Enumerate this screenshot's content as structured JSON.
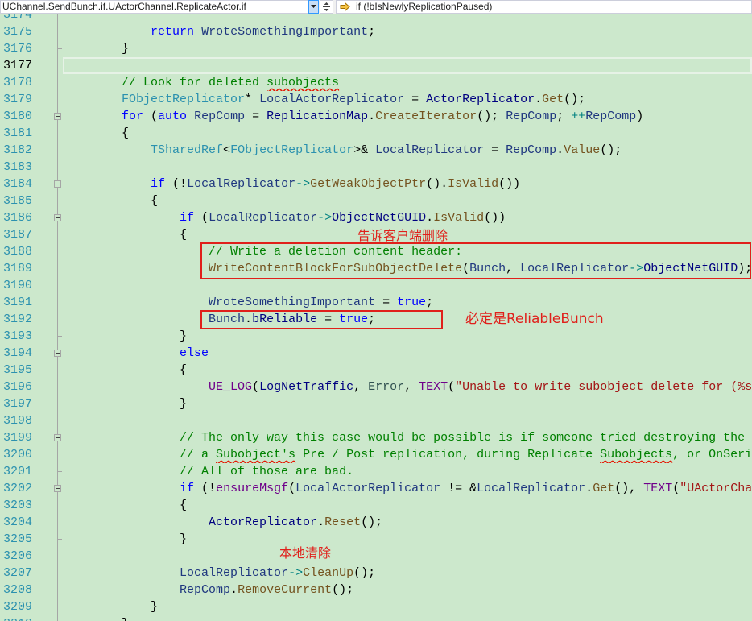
{
  "navbar": {
    "scope_dropdown": {
      "value": "UChannel.SendBunch.if.UActorChannel.ReplicateActor.if"
    },
    "scope_button_icon": "chevron-down-icon",
    "split_button_icon": "split-window-icon",
    "member_dropdown": {
      "value": "if (!bIsNewlyReplicationPaused)",
      "icon": "member-arrow-icon"
    }
  },
  "editor": {
    "lines": [
      {
        "n": "3174",
        "t": []
      },
      {
        "n": "3175",
        "t": [
          {
            "ws": "            "
          },
          {
            "kw": "return"
          },
          {
            "p": " "
          },
          {
            "v": "WroteSomethingImportant"
          },
          {
            "p": ";"
          }
        ]
      },
      {
        "n": "3176",
        "t": [
          {
            "ws": "        "
          },
          {
            "p": "}"
          }
        ],
        "fe": true
      },
      {
        "n": "3177",
        "t": [],
        "current": true
      },
      {
        "n": "3178",
        "t": [
          {
            "ws": "        "
          },
          {
            "c": "// Look for deleted "
          },
          {
            "cs": "subobjects"
          }
        ]
      },
      {
        "n": "3179",
        "t": [
          {
            "ws": "        "
          },
          {
            "ty": "FObjectReplicator"
          },
          {
            "p": "* "
          },
          {
            "v": "LocalActorReplicator"
          },
          {
            "p": " = "
          },
          {
            "m": "ActorReplicator"
          },
          {
            "p": "."
          },
          {
            "f": "Get"
          },
          {
            "p": "();"
          }
        ]
      },
      {
        "n": "3180",
        "t": [
          {
            "ws": "        "
          },
          {
            "kw": "for"
          },
          {
            "p": " ("
          },
          {
            "kw": "auto"
          },
          {
            "p": " "
          },
          {
            "v": "RepComp"
          },
          {
            "p": " = "
          },
          {
            "m": "ReplicationMap"
          },
          {
            "p": "."
          },
          {
            "f": "CreateIterator"
          },
          {
            "p": "(); "
          },
          {
            "v": "RepComp"
          },
          {
            "p": "; "
          },
          {
            "op": "++"
          },
          {
            "v": "RepComp"
          },
          {
            "p": ")"
          }
        ],
        "fs": true
      },
      {
        "n": "3181",
        "t": [
          {
            "ws": "        "
          },
          {
            "p": "{"
          }
        ]
      },
      {
        "n": "3182",
        "t": [
          {
            "ws": "            "
          },
          {
            "ty": "TSharedRef"
          },
          {
            "p": "<"
          },
          {
            "ty": "FObjectReplicator"
          },
          {
            "p": ">& "
          },
          {
            "v": "LocalReplicator"
          },
          {
            "p": " = "
          },
          {
            "v": "RepComp"
          },
          {
            "p": "."
          },
          {
            "f": "Value"
          },
          {
            "p": "();"
          }
        ]
      },
      {
        "n": "3183",
        "t": []
      },
      {
        "n": "3184",
        "t": [
          {
            "ws": "            "
          },
          {
            "kw": "if"
          },
          {
            "p": " (!"
          },
          {
            "v": "LocalReplicator"
          },
          {
            "op": "->"
          },
          {
            "f": "GetWeakObjectPtr"
          },
          {
            "p": "()."
          },
          {
            "f": "IsValid"
          },
          {
            "p": "())"
          }
        ],
        "fs": true
      },
      {
        "n": "3185",
        "t": [
          {
            "ws": "            "
          },
          {
            "p": "{"
          }
        ]
      },
      {
        "n": "3186",
        "t": [
          {
            "ws": "                "
          },
          {
            "kw": "if"
          },
          {
            "p": " ("
          },
          {
            "v": "LocalReplicator"
          },
          {
            "op": "->"
          },
          {
            "m": "ObjectNetGUID"
          },
          {
            "p": "."
          },
          {
            "f": "IsValid"
          },
          {
            "p": "())"
          }
        ],
        "fs": true
      },
      {
        "n": "3187",
        "t": [
          {
            "ws": "                "
          },
          {
            "p": "{"
          }
        ]
      },
      {
        "n": "3188",
        "t": [
          {
            "ws": "                    "
          },
          {
            "c": "// Write a deletion content header:"
          }
        ]
      },
      {
        "n": "3189",
        "t": [
          {
            "ws": "                    "
          },
          {
            "f": "WriteContentBlockForSubObjectDelete"
          },
          {
            "p": "("
          },
          {
            "v": "Bunch"
          },
          {
            "p": ", "
          },
          {
            "v": "LocalReplicator"
          },
          {
            "op": "->"
          },
          {
            "m": "ObjectNetGUID"
          },
          {
            "p": ");"
          }
        ]
      },
      {
        "n": "3190",
        "t": []
      },
      {
        "n": "3191",
        "t": [
          {
            "ws": "                    "
          },
          {
            "v": "WroteSomethingImportant"
          },
          {
            "p": " = "
          },
          {
            "kw": "true"
          },
          {
            "p": ";"
          }
        ]
      },
      {
        "n": "3192",
        "t": [
          {
            "ws": "                    "
          },
          {
            "v": "Bunch"
          },
          {
            "p": "."
          },
          {
            "m": "bReliable"
          },
          {
            "p": " = "
          },
          {
            "kw": "true"
          },
          {
            "p": ";"
          }
        ]
      },
      {
        "n": "3193",
        "t": [
          {
            "ws": "                "
          },
          {
            "p": "}"
          }
        ],
        "fe": true
      },
      {
        "n": "3194",
        "t": [
          {
            "ws": "                "
          },
          {
            "kw": "else"
          }
        ],
        "fs": true
      },
      {
        "n": "3195",
        "t": [
          {
            "ws": "                "
          },
          {
            "p": "{"
          }
        ]
      },
      {
        "n": "3196",
        "t": [
          {
            "ws": "                    "
          },
          {
            "mc": "UE_LOG"
          },
          {
            "p": "("
          },
          {
            "m": "LogNetTraffic"
          },
          {
            "p": ", "
          },
          {
            "e": "Error"
          },
          {
            "p": ", "
          },
          {
            "mc": "TEXT"
          },
          {
            "p": "("
          },
          {
            "s": "\"Unable to write subobject delete for (%s"
          }
        ]
      },
      {
        "n": "3197",
        "t": [
          {
            "ws": "                "
          },
          {
            "p": "}"
          }
        ],
        "fe": true
      },
      {
        "n": "3198",
        "t": []
      },
      {
        "n": "3199",
        "t": [
          {
            "ws": "                "
          },
          {
            "c": "// The only way this case would be possible is if someone tried destroying the"
          }
        ],
        "fs": true
      },
      {
        "n": "3200",
        "t": [
          {
            "ws": "                "
          },
          {
            "c": "// a "
          },
          {
            "cs": "Subobject's"
          },
          {
            "c": " Pre / Post replication, during Replicate "
          },
          {
            "cs": "Subobjects"
          },
          {
            "c": ", or OnSeri"
          }
        ]
      },
      {
        "n": "3201",
        "t": [
          {
            "ws": "                "
          },
          {
            "c": "// All of those are bad."
          }
        ],
        "fe": true
      },
      {
        "n": "3202",
        "t": [
          {
            "ws": "                "
          },
          {
            "kw": "if"
          },
          {
            "p": " (!"
          },
          {
            "mc": "ensureMsgf"
          },
          {
            "p": "("
          },
          {
            "v": "LocalActorReplicator"
          },
          {
            "p": " != &"
          },
          {
            "v": "LocalReplicator"
          },
          {
            "p": "."
          },
          {
            "f": "Get"
          },
          {
            "p": "(), "
          },
          {
            "mc": "TEXT"
          },
          {
            "p": "("
          },
          {
            "s": "\"UActorCha"
          }
        ],
        "fs": true
      },
      {
        "n": "3203",
        "t": [
          {
            "ws": "                "
          },
          {
            "p": "{"
          }
        ]
      },
      {
        "n": "3204",
        "t": [
          {
            "ws": "                    "
          },
          {
            "m": "ActorReplicator"
          },
          {
            "p": "."
          },
          {
            "f": "Reset"
          },
          {
            "p": "();"
          }
        ]
      },
      {
        "n": "3205",
        "t": [
          {
            "ws": "                "
          },
          {
            "p": "}"
          }
        ],
        "fe": true
      },
      {
        "n": "3206",
        "t": []
      },
      {
        "n": "3207",
        "t": [
          {
            "ws": "                "
          },
          {
            "v": "LocalReplicator"
          },
          {
            "op": "->"
          },
          {
            "f": "CleanUp"
          },
          {
            "p": "();"
          }
        ]
      },
      {
        "n": "3208",
        "t": [
          {
            "ws": "                "
          },
          {
            "v": "RepComp"
          },
          {
            "p": "."
          },
          {
            "f": "RemoveCurrent"
          },
          {
            "p": "();"
          }
        ]
      },
      {
        "n": "3209",
        "t": [
          {
            "ws": "            "
          },
          {
            "p": "}"
          }
        ],
        "fe": true
      },
      {
        "n": "3210",
        "t": [
          {
            "ws": "        "
          },
          {
            "p": "}"
          }
        ]
      }
    ]
  },
  "annotations": {
    "delete_note": "告诉客户端删除",
    "reliable_note": "必定是ReliableBunch",
    "cleanup_note": "本地清除"
  },
  "theme": {
    "background": "#CCE8CC",
    "line_number": "#2B91AF",
    "current_line_number": "#000000",
    "keyword": "#0000FF",
    "type": "#2B91AF",
    "function": "#74531F",
    "local_variable": "#1F377F",
    "member": "#000080",
    "comment": "#008000",
    "string": "#A31515",
    "macro": "#6F008A",
    "enum": "#2F4F4F",
    "operator_overload": "#008080",
    "annotation_red": "#E0201B",
    "spell_squiggle": "#E51400"
  }
}
